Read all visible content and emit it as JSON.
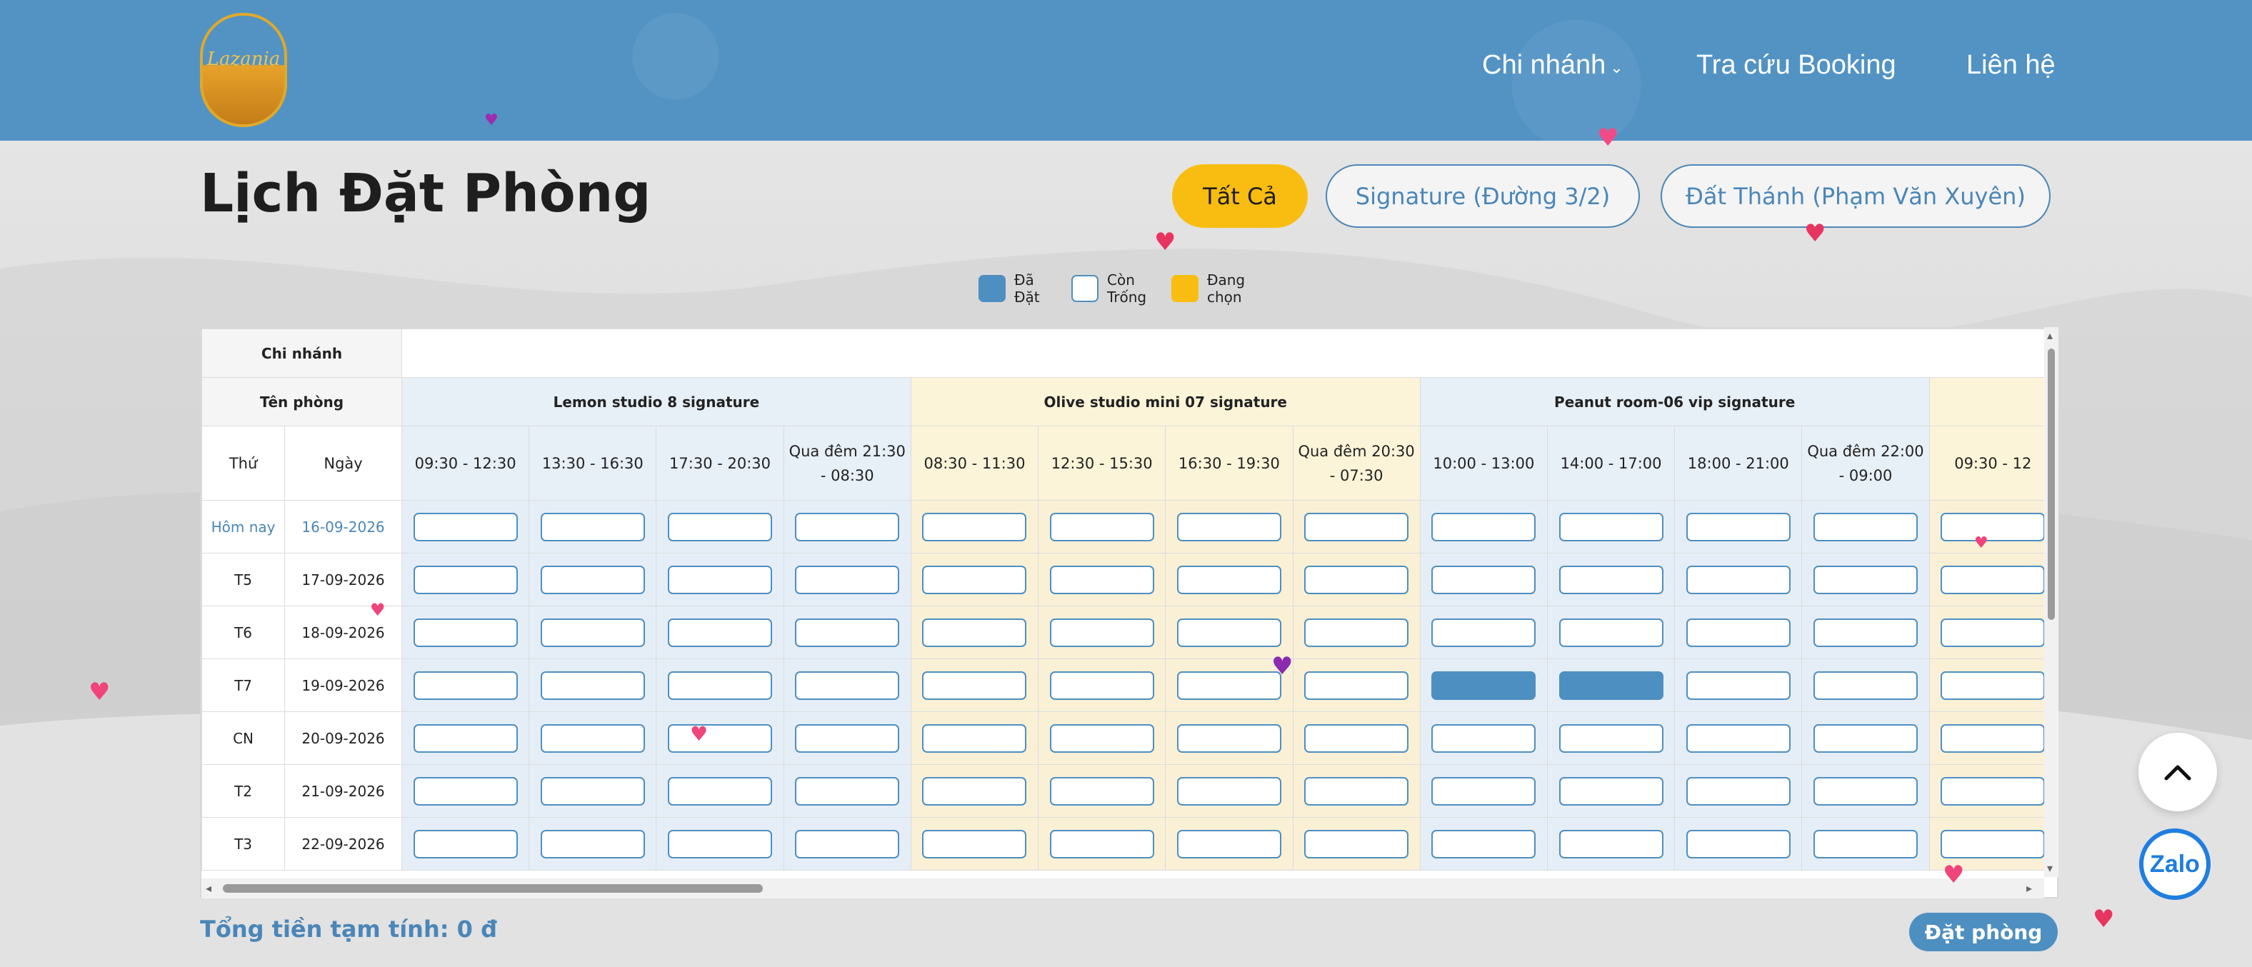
{
  "header": {
    "logo_text": "Lazania",
    "nav": [
      {
        "label": "Chi nhánh"
      },
      {
        "label": "Tra cứu Booking"
      },
      {
        "label": "Liên hệ"
      }
    ]
  },
  "page_title": "Lịch Đặt Phòng",
  "filters": {
    "all": "Tất Cả",
    "signature": "Signature (Đường 3/2)",
    "dat_thanh": "Đất Thánh (Phạm Văn Xuyên)"
  },
  "legend": {
    "booked": "Đã Đặt",
    "free": "Còn Trống",
    "selected": "Đang chọn"
  },
  "colors": {
    "header": "#5293c4",
    "accent_yellow": "#f8bd10",
    "booked": "#4e8fc1"
  },
  "table": {
    "label_branch": "Chi nhánh",
    "label_room": "Tên phòng",
    "label_weekday": "Thứ",
    "label_date": "Ngày",
    "rooms": [
      {
        "name": "Lemon studio 8 signature",
        "tone": "blue",
        "slots": [
          "09:30 - 12:30",
          "13:30 - 16:30",
          "17:30 - 20:30",
          "Qua đêm 21:30 - 08:30"
        ]
      },
      {
        "name": "Olive studio mini 07 signature",
        "tone": "yel",
        "slots": [
          "08:30 - 11:30",
          "12:30 - 15:30",
          "16:30 - 19:30",
          "Qua đêm 20:30 - 07:30"
        ]
      },
      {
        "name": "Peanut room-06 vip signature",
        "tone": "blue",
        "slots": [
          "10:00 - 13:00",
          "14:00 - 17:00",
          "18:00 - 21:00",
          "Qua đêm 22:00 - 09:00"
        ]
      },
      {
        "name": "",
        "tone": "yel",
        "slots": [
          "09:30 - 12"
        ]
      }
    ],
    "rows": [
      {
        "weekday": "Hôm nay",
        "date": "16-09-2026",
        "today": true,
        "booked": []
      },
      {
        "weekday": "T5",
        "date": "17-09-2026",
        "booked": []
      },
      {
        "weekday": "T6",
        "date": "18-09-2026",
        "booked": []
      },
      {
        "weekday": "T7",
        "date": "19-09-2026",
        "booked": [
          8,
          9
        ]
      },
      {
        "weekday": "CN",
        "date": "20-09-2026",
        "booked": []
      },
      {
        "weekday": "T2",
        "date": "21-09-2026",
        "booked": []
      },
      {
        "weekday": "T3",
        "date": "22-09-2026",
        "booked": []
      }
    ]
  },
  "footer": {
    "total_label": "Tổng tiền tạm tính: 0 đ",
    "book_button": "Đặt phòng",
    "zalo_label": "Zalo"
  }
}
